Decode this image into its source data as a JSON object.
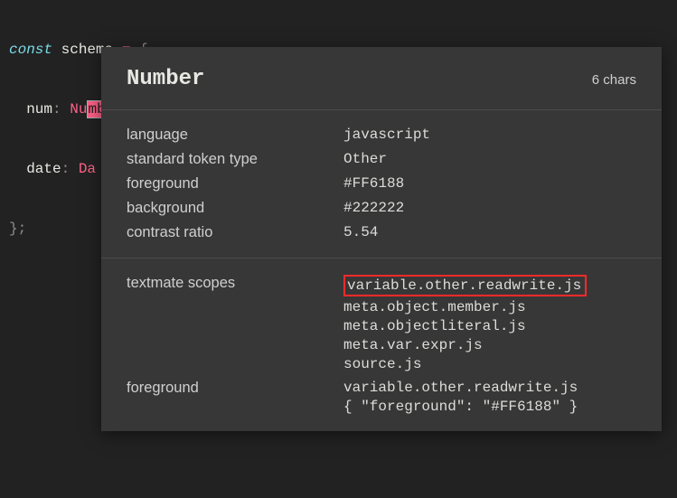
{
  "editor": {
    "line1": {
      "kw": "const",
      "name": "schema",
      "eq": "=",
      "brace": "{"
    },
    "line2": {
      "key": "num",
      "colon": ":",
      "token": "Number",
      "comma": ","
    },
    "line3": {
      "key": "date",
      "colon": ":",
      "token": "Da"
    },
    "line4": {
      "close": "};"
    }
  },
  "tooltip": {
    "title": "Number",
    "chars": "6 chars",
    "rows1": [
      {
        "label": "language",
        "value": "javascript"
      },
      {
        "label": "standard token type",
        "value": "Other"
      },
      {
        "label": "foreground",
        "value": "#FF6188"
      },
      {
        "label": "background",
        "value": "#222222"
      },
      {
        "label": "contrast ratio",
        "value": "5.54"
      }
    ],
    "rows2": {
      "scopes_label": "textmate scopes",
      "scopes": [
        "variable.other.readwrite.js",
        "meta.object.member.js",
        "meta.objectliteral.js",
        "meta.var.expr.js",
        "source.js"
      ],
      "fg_label": "foreground",
      "fg_lines": [
        "variable.other.readwrite.js",
        "{ \"foreground\": \"#FF6188\" }"
      ]
    }
  }
}
